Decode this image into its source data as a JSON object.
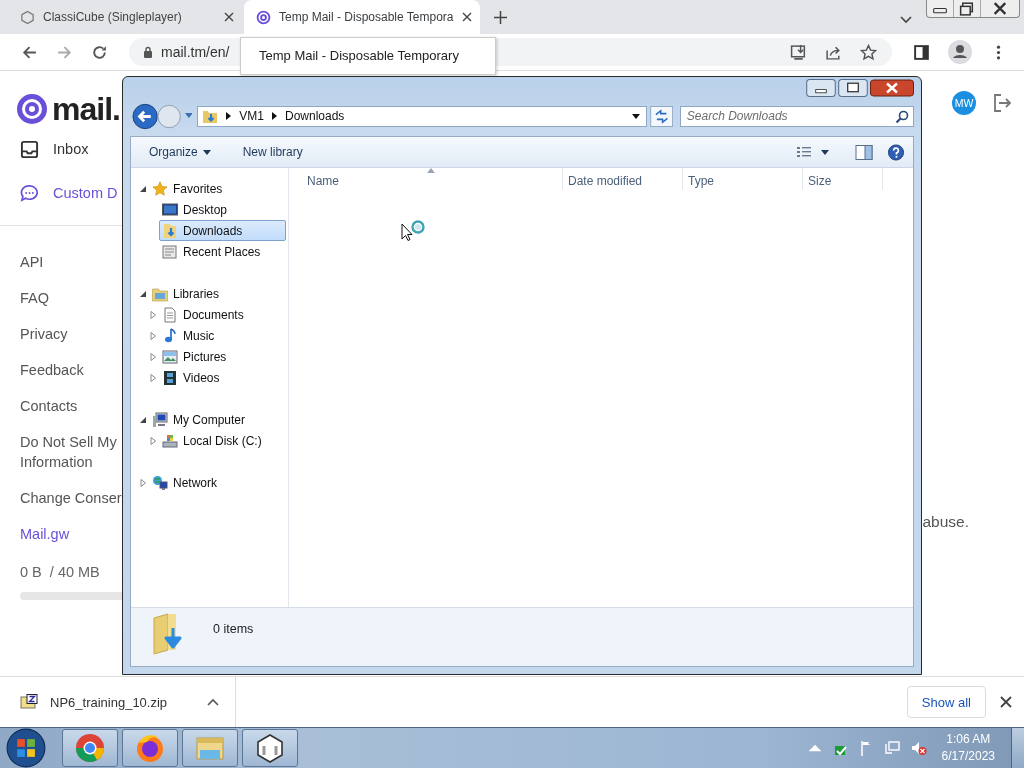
{
  "browser": {
    "tabs": [
      {
        "title": "ClassiCube (Singleplayer)",
        "selected": false
      },
      {
        "title": "Temp Mail - Disposable Tempora",
        "selected": true
      }
    ],
    "address": "mail.tm/en/",
    "tooltip": "Temp Mail - Disposable Temporary"
  },
  "page": {
    "logo": "mail.",
    "nav": [
      {
        "label": "Inbox",
        "selected": false,
        "kind": "inbox"
      },
      {
        "label": "Custom D",
        "selected": true,
        "kind": "chat"
      }
    ],
    "links": [
      {
        "label": "API",
        "kind": "plain"
      },
      {
        "label": "FAQ",
        "kind": "plain"
      },
      {
        "label": "Privacy",
        "kind": "plain"
      },
      {
        "label": "Feedback",
        "kind": "plain"
      },
      {
        "label": "Contacts",
        "kind": "plain"
      },
      {
        "label": "Do Not Sell My Information",
        "kind": "plain"
      },
      {
        "label": "Change Conser",
        "kind": "plain"
      },
      {
        "label": "Mail.gw",
        "kind": "accent"
      }
    ],
    "storage": {
      "text": "0 B  / 40 MB"
    },
    "avatar": "MW",
    "body_text": "abuse."
  },
  "explorer": {
    "breadcrumb": [
      "VM1",
      "Downloads"
    ],
    "search_placeholder": "Search Downloads",
    "commands": [
      {
        "label": "Organize",
        "kind": "menu"
      },
      {
        "label": "New library",
        "kind": "button"
      }
    ],
    "tree": [
      {
        "label": "Favorites",
        "kind": "star",
        "expanded": true,
        "selected": false,
        "children": [
          {
            "label": "Desktop",
            "kind": "desktop",
            "selected": false
          },
          {
            "label": "Downloads",
            "kind": "downloads",
            "selected": true
          },
          {
            "label": "Recent Places",
            "kind": "recent",
            "selected": false
          }
        ]
      },
      {
        "label": "Libraries",
        "kind": "library",
        "expanded": true,
        "selected": false,
        "children": [
          {
            "label": "Documents",
            "kind": "document",
            "expanded": false,
            "selected": false
          },
          {
            "label": "Music",
            "kind": "music",
            "expanded": false,
            "selected": false
          },
          {
            "label": "Pictures",
            "kind": "picture",
            "expanded": false,
            "selected": false
          },
          {
            "label": "Videos",
            "kind": "video",
            "expanded": false,
            "selected": false
          }
        ]
      },
      {
        "label": "My Computer",
        "kind": "computer",
        "expanded": true,
        "selected": false,
        "children": [
          {
            "label": "Local Disk (C:)",
            "kind": "disk",
            "expanded": false,
            "selected": false
          }
        ]
      },
      {
        "label": "Network",
        "kind": "network",
        "expanded": false,
        "selected": false
      }
    ],
    "columns": [
      "Name",
      "Date modified",
      "Type",
      "Size"
    ],
    "status": "0 items"
  },
  "downloads": {
    "file": "NP6_training_10.zip",
    "show_all": "Show all"
  },
  "taskbar": {
    "time": "1:06 AM",
    "date": "6/17/2023"
  }
}
